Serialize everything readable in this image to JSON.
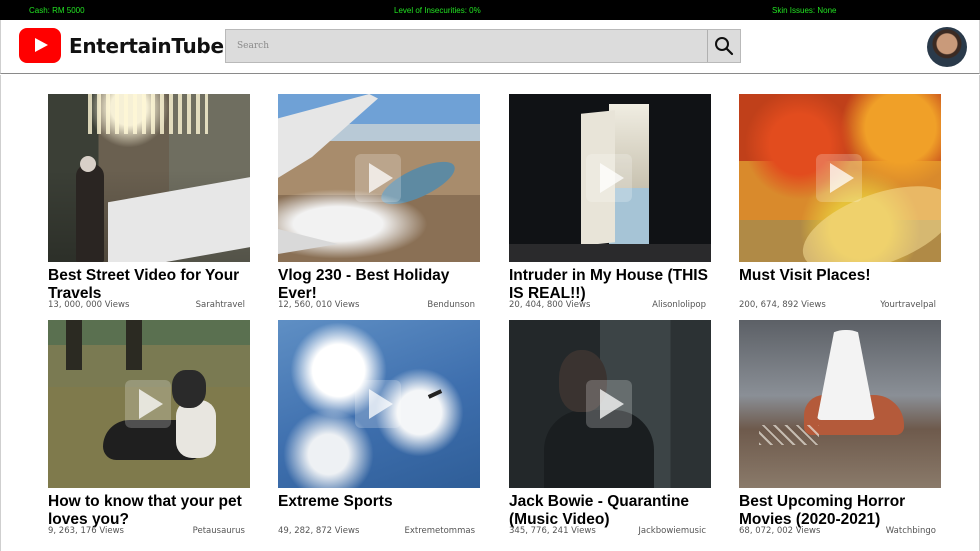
{
  "status_bar": {
    "cash": "Cash: RM 5000",
    "insecurities": "Level of Insecurities: 0%",
    "skin": "Skin Issues: None"
  },
  "header": {
    "logo_text": "EntertainTube",
    "search_placeholder": "Search"
  },
  "videos": [
    {
      "title": "Best Street Video for Your Travels",
      "views": "13, 000, 000 Views",
      "channel": "Sarahtravel"
    },
    {
      "title": "Vlog 230 - Best Holiday Ever!",
      "views": "12, 560, 010 Views",
      "channel": "Bendunson"
    },
    {
      "title": "Intruder in My House (THIS IS REAL!!)",
      "views": "20, 404, 800 Views",
      "channel": "Alisonlolipop"
    },
    {
      "title": "Must Visit Places!",
      "views": "200, 674, 892 Views",
      "channel": "Yourtravelpal"
    },
    {
      "title": "How to know that your pet loves you?",
      "views": "9, 263, 176 Views",
      "channel": "Petausaurus"
    },
    {
      "title": "Extreme Sports",
      "views": "49, 282, 872 Views",
      "channel": "Extremetommas"
    },
    {
      "title": "Jack Bowie - Quarantine (Music Video)",
      "views": "345, 776, 241 Views",
      "channel": "Jackbowiemusic"
    },
    {
      "title": "Best Upcoming Horror Movies (2020-2021)",
      "views": "68, 072, 002 Views",
      "channel": "Watchbingo"
    }
  ],
  "colors": {
    "brand_red": "#ff0000",
    "status_green": "#22e322"
  }
}
